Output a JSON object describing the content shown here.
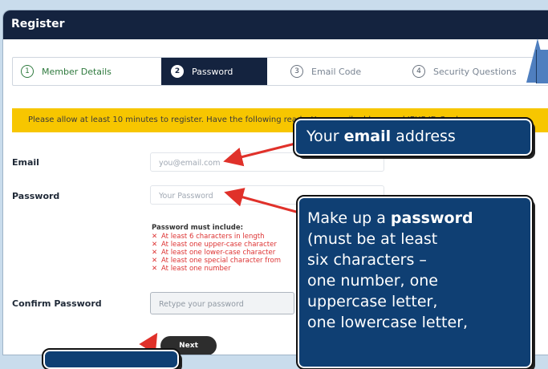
{
  "header": {
    "title": "Register"
  },
  "steps": [
    {
      "num": "1",
      "label": "Member Details"
    },
    {
      "num": "2",
      "label": "Password"
    },
    {
      "num": "3",
      "label": "Email Code"
    },
    {
      "num": "4",
      "label": "Security Questions"
    }
  ],
  "banner": {
    "text": "Please allow at least 10 minutes to register. Have the following ready: Your email address and IEHP ID Card."
  },
  "form": {
    "email_label": "Email",
    "email_placeholder": "you@email.com",
    "password_label": "Password",
    "password_placeholder": "Your Password",
    "requirements_title": "Password must include:",
    "requirements": [
      "At least 6 characters in length",
      "At least one upper-case character",
      "At least one lower-case character",
      "At least one special character from",
      "At least one number"
    ],
    "confirm_label": "Confirm Password",
    "confirm_placeholder": "Retype your password",
    "next_label": "Next"
  },
  "callouts": {
    "email_pre": "Your ",
    "email_bold": "email",
    "email_post": " address",
    "password_line1_pre": "Make up a ",
    "password_line1_bold": "password",
    "password_line2": "(must be at least",
    "password_line3": "six characters –",
    "password_line4": "one number, one",
    "password_line5": "uppercase letter,",
    "password_line6": "one lowercase letter,"
  },
  "colors": {
    "header": "#14233f",
    "banner": "#f7c600",
    "callout": "#0f3f73",
    "arrow": "#e0312a",
    "step_done": "#2f7a3e"
  }
}
